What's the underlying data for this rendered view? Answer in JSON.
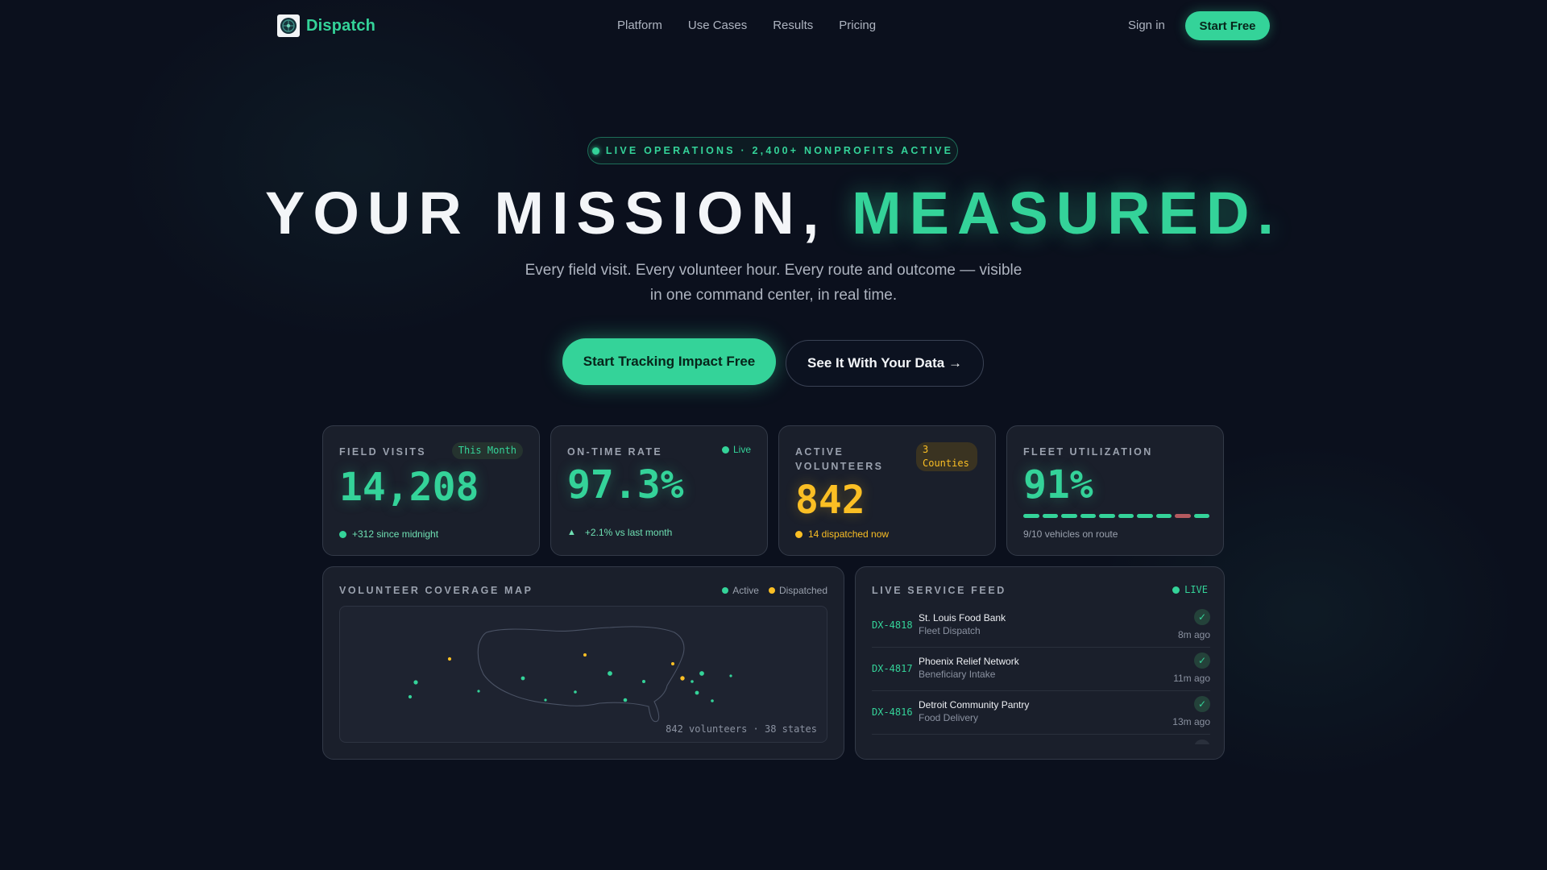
{
  "brand": {
    "name": "Dispatch"
  },
  "nav": {
    "links": [
      "Platform",
      "Use Cases",
      "Results",
      "Pricing"
    ],
    "signin": "Sign in",
    "cta": "Start Free"
  },
  "hero": {
    "pill": "LIVE OPERATIONS · 2,400+ NONPROFITS ACTIVE",
    "title_part1": "YOUR MISSION, ",
    "title_part2": "MEASURED.",
    "subtitle_line1": "Every field visit. Every volunteer hour. Every route and outcome — visible",
    "subtitle_line2": "in one command center, in real time.",
    "cta_primary": "Start Tracking Impact Free",
    "cta_secondary": "See It With Your Data →"
  },
  "stats": {
    "field_visits": {
      "label": "FIELD VISITS",
      "badge": "This Month",
      "value": "14,208",
      "foot": "+312 since midnight"
    },
    "on_time": {
      "label": "ON-TIME RATE",
      "badge": "Live",
      "value": "97.3%",
      "foot_icon": "▲",
      "foot": "+2.1% vs last month"
    },
    "volunteers": {
      "label_line1": "ACTIVE",
      "label_line2": "VOLUNTEERS",
      "badge_line1": "3",
      "badge_line2": "Counties",
      "value": "842",
      "foot": "14 dispatched now"
    },
    "fleet": {
      "label": "FLEET UTILIZATION",
      "value": "91%",
      "foot": "9/10 vehicles on route"
    }
  },
  "map": {
    "title": "VOLUNTEER COVERAGE MAP",
    "legend_active": "Active",
    "legend_dispatched": "Dispatched",
    "caption": "842 volunteers · 38 states"
  },
  "feed": {
    "title": "LIVE SERVICE FEED",
    "live": "LIVE",
    "items": [
      {
        "id": "DX-4818",
        "org": "St. Louis Food Bank",
        "type": "Fleet Dispatch",
        "time": "8m ago"
      },
      {
        "id": "DX-4817",
        "org": "Phoenix Relief Network",
        "type": "Beneficiary Intake",
        "time": "11m ago"
      },
      {
        "id": "DX-4816",
        "org": "Detroit Community Pantry",
        "type": "Food Delivery",
        "time": "13m ago"
      }
    ]
  },
  "colors": {
    "accent": "#34d399",
    "amber": "#fbbf24",
    "background": "#0b101d",
    "card": "#1a1f2b",
    "warning_segment": "#b45a5f"
  },
  "icons": {
    "logo": "globe-network-icon",
    "check": "check-icon",
    "trend": "triangle-up-icon"
  }
}
